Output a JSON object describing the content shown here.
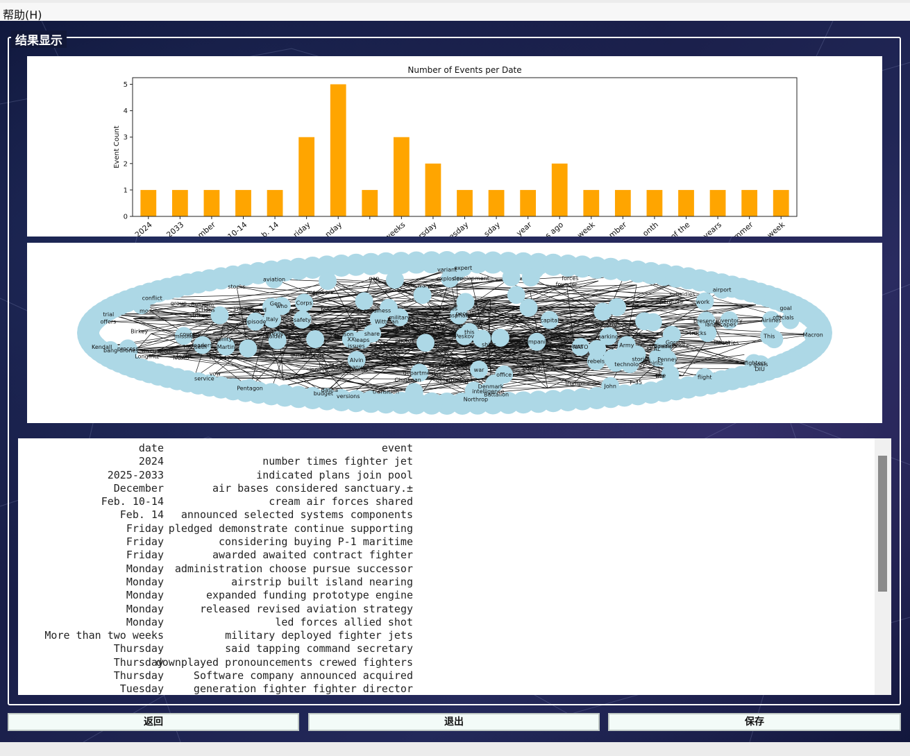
{
  "menu": {
    "help": "帮助(H)"
  },
  "group_title": "结果显示",
  "chart_data": {
    "type": "bar",
    "title": "Number of Events per Date",
    "xlabel": "",
    "ylabel": "Event Count",
    "ylim": [
      0,
      5.25
    ],
    "yticks": [
      0,
      1,
      2,
      3,
      4,
      5
    ],
    "bar_color": "#ffa500",
    "categories": [
      "2024",
      "2033",
      "mber",
      "10-14",
      "b. 14",
      "riday",
      "nday",
      "",
      "weeks",
      "rsday",
      "esday",
      "sday",
      "year",
      "s ago",
      "week",
      "mber",
      "onth",
      "of the",
      "years",
      "mmer",
      "week"
    ],
    "values": [
      1,
      1,
      1,
      1,
      1,
      3,
      5,
      1,
      3,
      2,
      1,
      1,
      1,
      2,
      1,
      1,
      1,
      1,
      1,
      1,
      1
    ],
    "grid": false
  },
  "network": {
    "node_color": "#add8e6",
    "labels": [
      "missile",
      "review",
      "runway",
      "goals",
      "sessions",
      "issues",
      "office",
      "impact",
      "ships",
      "war",
      "discussions",
      "series",
      "bang",
      "landscapes",
      "readiness",
      "intelligence",
      "Raider",
      "photos",
      "airport",
      "zone",
      "strikes",
      "expert",
      "founder",
      "Judson",
      "Peskov",
      "versions",
      "offers",
      "leaders",
      "Spirits",
      "trucks",
      "Airlines",
      "actions",
      "Northrop",
      "markings",
      "intent",
      "group",
      "this",
      "forces",
      "military",
      "Ministry",
      "those",
      "XX",
      "sensors",
      "Taiwan",
      "drones",
      "Battalion",
      "SEAL",
      "This",
      "Emirati",
      "work",
      "leaps",
      "Kendall",
      "Trump",
      "NATO",
      "India",
      "Denmark",
      "department",
      "company",
      "service",
      "Pentagon",
      "Belgium",
      "officials",
      "Corps",
      "country",
      "Basha",
      "process",
      "gunner",
      "people",
      "John",
      "fee",
      "Marines",
      "Penney",
      "Birkey",
      "budget",
      "Italy",
      "transition",
      "technology",
      "F-35",
      "She",
      "Martin",
      "carrier",
      "DIU",
      "aviation",
      "Chapman",
      "ability",
      "companies",
      "members",
      "stocks",
      "Boeing",
      "Goretti",
      "operators",
      "capital",
      "waiver",
      "conflict",
      "inventory",
      "missions",
      "trainer",
      "safety",
      "tanks",
      "Wittman",
      "Army",
      "stories",
      "Gen.",
      "asphalt",
      "NGAD",
      "vow",
      "Macron",
      "variant",
      "deterrent",
      "rebels",
      "funds",
      "models",
      "speed",
      "goal",
      "episode",
      "development",
      "Longfritz",
      "explosion",
      "pilot",
      "gap",
      "share",
      "issues",
      "fighters",
      "flight",
      "trial",
      "subsidies",
      "presence",
      "innovation",
      "Hegseth",
      "Alvin",
      "the",
      "she",
      "who",
      "I",
      "d"
    ]
  },
  "table": {
    "headers": {
      "date": "date",
      "event": "event"
    },
    "rows": [
      {
        "date": "2024",
        "event": "number times fighter jet"
      },
      {
        "date": "2025-2033",
        "event": "indicated plans join pool"
      },
      {
        "date": "December",
        "event": "air bases considered sanctuary.±"
      },
      {
        "date": "Feb. 10-14",
        "event": "cream air forces shared"
      },
      {
        "date": "Feb. 14",
        "event": "announced selected systems components"
      },
      {
        "date": "Friday",
        "event": "pledged demonstrate continue supporting"
      },
      {
        "date": "Friday",
        "event": "considering buying P-1 maritime"
      },
      {
        "date": "Friday",
        "event": "awarded awaited contract fighter"
      },
      {
        "date": "Monday",
        "event": "administration choose pursue successor"
      },
      {
        "date": "Monday",
        "event": "airstrip built island nearing"
      },
      {
        "date": "Monday",
        "event": "expanded funding prototype engine"
      },
      {
        "date": "Monday",
        "event": "released revised aviation strategy"
      },
      {
        "date": "Monday",
        "event": "led forces allied shot"
      },
      {
        "date": "More than two weeks",
        "event": "military deployed fighter jets"
      },
      {
        "date": "Thursday",
        "event": "said tapping command secretary"
      },
      {
        "date": "Thursday",
        "event": "downplayed pronouncements crewed fighters"
      },
      {
        "date": "Thursday",
        "event": "Software company announced acquired"
      },
      {
        "date": "Tuesday",
        "event": "generation fighter fighter director"
      }
    ]
  },
  "buttons": {
    "back": "返回",
    "exit": "退出",
    "save": "保存"
  }
}
